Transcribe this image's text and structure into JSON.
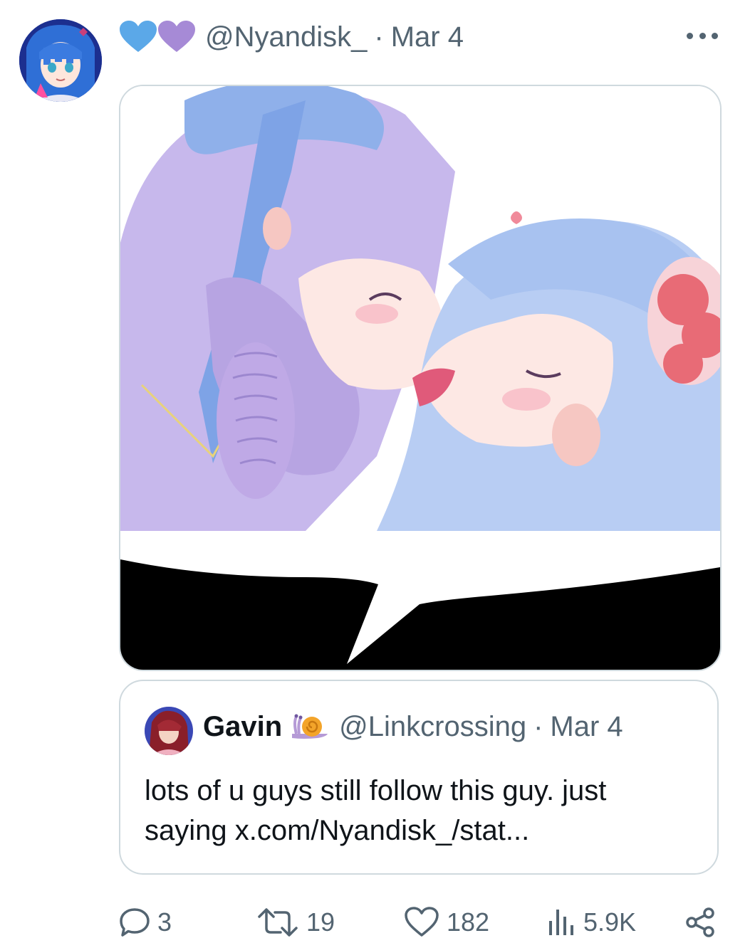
{
  "tweet": {
    "author_handle": "@Nyandisk_",
    "separator": "·",
    "date": "Mar 4",
    "avatar_icon": "anime-avatar-blue-hair",
    "name_emojis": [
      "blue-heart-icon",
      "purple-heart-icon"
    ],
    "more_icon": "more-dots-icon",
    "media": {
      "description_icon": "anime-illustration",
      "speech_bubble_icon": "speech-bubble-tail"
    }
  },
  "quote": {
    "name": "Gavin",
    "badge_icon": "snail-emoji",
    "handle": "@Linkcrossing",
    "separator": "·",
    "date": "Mar 4",
    "text": "lots of u guys still follow this guy. just saying x.com/Nyandisk_/stat..."
  },
  "actions": {
    "reply": {
      "icon": "reply-icon",
      "count": "3"
    },
    "retweet": {
      "icon": "retweet-icon",
      "count": "19"
    },
    "like": {
      "icon": "heart-icon",
      "count": "182"
    },
    "views": {
      "icon": "views-bar-chart-icon",
      "count": "5.9K"
    },
    "share": {
      "icon": "share-icon"
    }
  },
  "colors": {
    "muted": "#536471",
    "border": "#cfd9de",
    "blue_heart": "#5ba8e8",
    "purple_heart": "#a68ad6"
  }
}
